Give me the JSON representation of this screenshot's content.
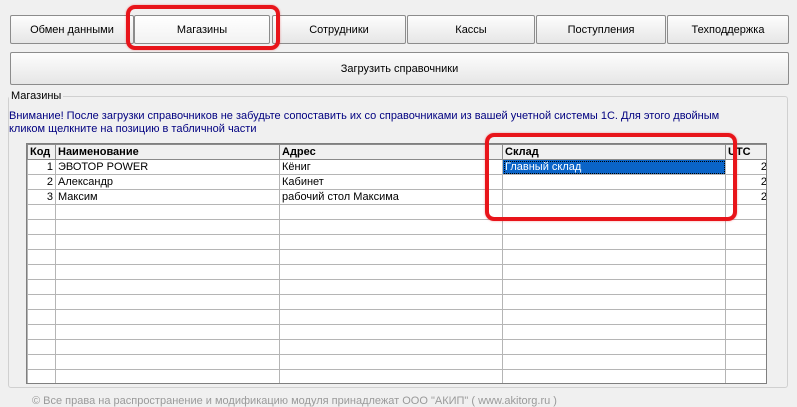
{
  "tabs": [
    {
      "label": "Обмен данными"
    },
    {
      "label": "Магазины"
    },
    {
      "label": "Сотрудники"
    },
    {
      "label": "Кассы"
    },
    {
      "label": "Поступления"
    },
    {
      "label": "Техподдержка"
    }
  ],
  "load_button": {
    "label": "Загрузить справочники"
  },
  "group": {
    "title": "Магазины",
    "notice": "Внимание! После загрузки справочников не забудьте сопоставить их со справочниками из вашей учетной системы 1С.  Для этого двойным кликом щелкните на позицию в табличной части"
  },
  "table": {
    "columns": [
      "Код",
      "Наименование",
      "Адрес",
      "Склад",
      "UTC"
    ],
    "rows": [
      {
        "code": "1",
        "name": "ЭВОТОР POWER",
        "address": "Кёниг",
        "warehouse": "Главный склад",
        "utc": "2"
      },
      {
        "code": "2",
        "name": "Александр",
        "address": "Кабинет",
        "warehouse": "",
        "utc": "2"
      },
      {
        "code": "3",
        "name": "Максим",
        "address": "рабочий стол Максима",
        "warehouse": "",
        "utc": "2"
      }
    ]
  },
  "footer": {
    "text": "© Все права на распространение и модификацию модуля принадлежат ООО \"АКИП\" ( www.akitorg.ru )"
  },
  "colors": {
    "highlight": "#e8141a",
    "selection": "#0a64c8",
    "notice_text": "#000080"
  }
}
